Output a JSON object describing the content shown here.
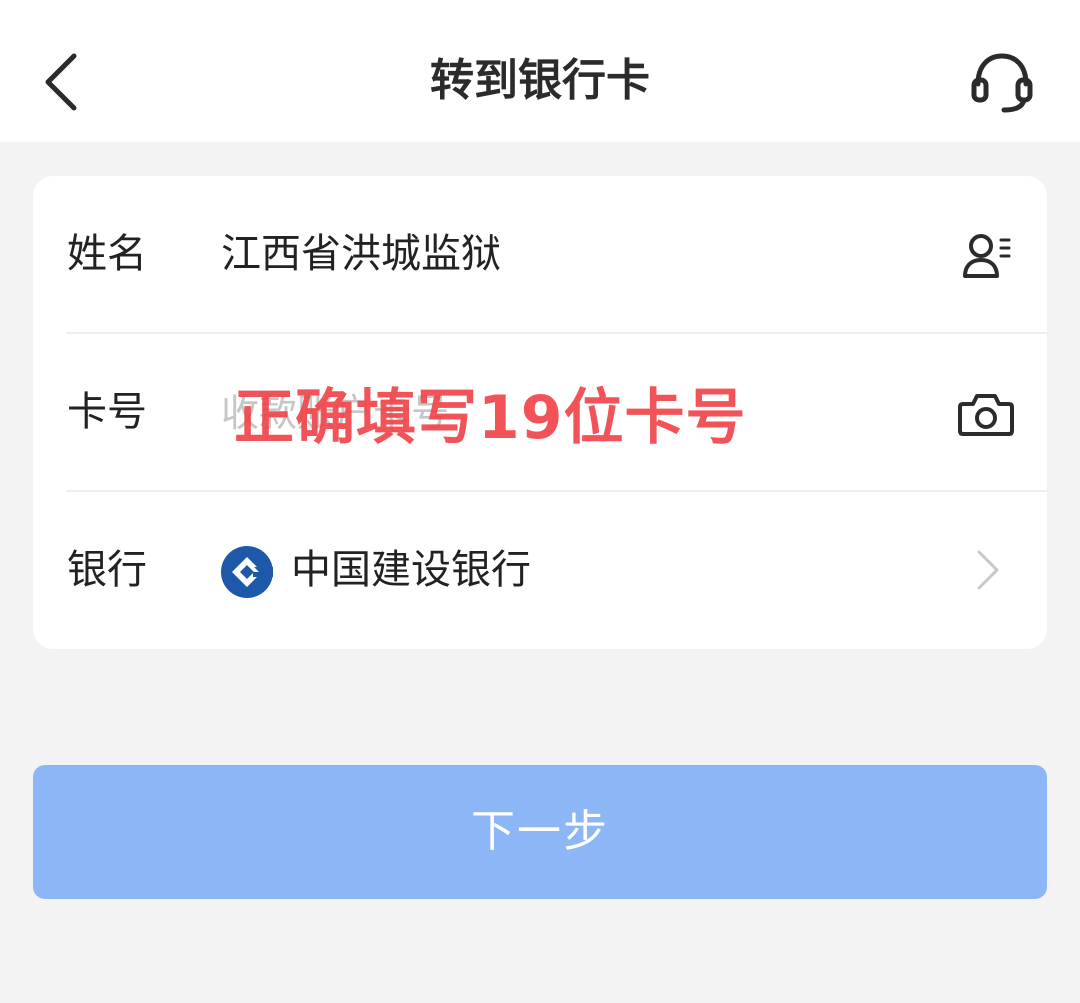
{
  "header": {
    "title": "转到银行卡",
    "back_icon": "chevron-left-icon",
    "support_icon": "headset-icon"
  },
  "form": {
    "name_row": {
      "label": "姓名",
      "value": "江西省洪城监狱",
      "icon": "contacts-icon"
    },
    "card_row": {
      "label": "卡号",
      "placeholder": "收款账户卡号",
      "value": "",
      "icon": "camera-icon"
    },
    "bank_row": {
      "label": "银行",
      "value": "中国建设银行",
      "icon": "chevron-right-icon",
      "logo": "ccb-logo"
    }
  },
  "overlay_hint": "正确填写19位卡号",
  "next_button": "下一步",
  "colors": {
    "button": "#8db6f7",
    "overlay_text": "#f0454a",
    "bank_logo": "#1e58a8",
    "background": "#f3f3f3"
  }
}
